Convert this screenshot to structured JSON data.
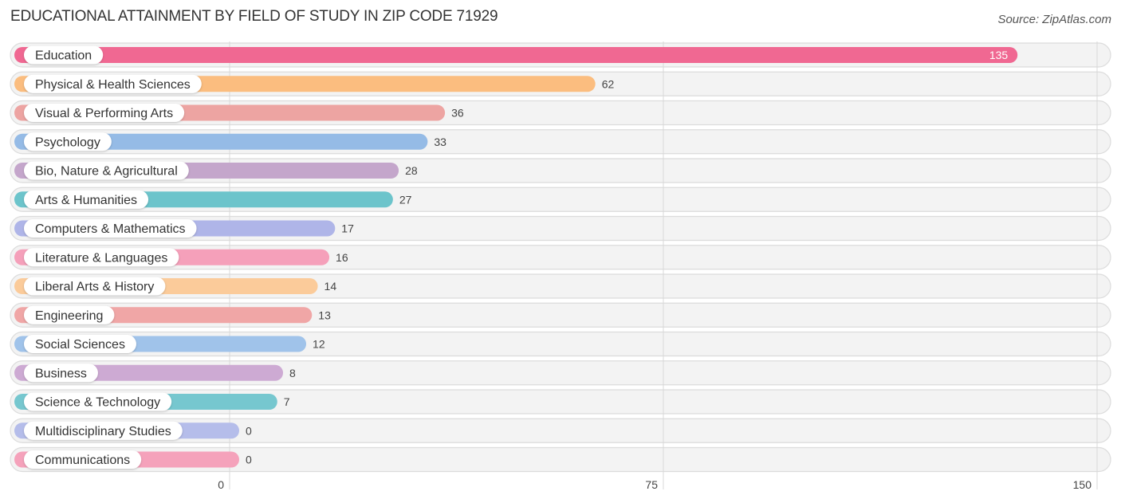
{
  "chart_data": {
    "type": "bar",
    "orientation": "horizontal",
    "title": "EDUCATIONAL ATTAINMENT BY FIELD OF STUDY IN ZIP CODE 71929",
    "source": "Source: ZipAtlas.com",
    "xlabel": "",
    "ylabel": "",
    "xlim": [
      0,
      150
    ],
    "ticks": [
      0,
      75,
      150
    ],
    "tick_labels": [
      "0",
      "75",
      "150"
    ],
    "grid": true,
    "legend": "none",
    "categories": [
      "Education",
      "Physical & Health Sciences",
      "Visual & Performing Arts",
      "Psychology",
      "Bio, Nature & Agricultural",
      "Arts & Humanities",
      "Computers & Mathematics",
      "Literature & Languages",
      "Liberal Arts & History",
      "Engineering",
      "Social Sciences",
      "Business",
      "Science & Technology",
      "Multidisciplinary Studies",
      "Communications"
    ],
    "values": [
      135,
      62,
      36,
      33,
      28,
      27,
      17,
      16,
      14,
      13,
      12,
      8,
      7,
      0,
      0
    ],
    "colors": [
      "#f06892",
      "#fbbd7f",
      "#eda4a2",
      "#95bbe6",
      "#c4a6cb",
      "#6cc4cb",
      "#afb5e8",
      "#f5a0ba",
      "#fbcb9a",
      "#f0a6a6",
      "#a0c3ea",
      "#cdaad3",
      "#76c7cf",
      "#b5bdea",
      "#f5a2bb"
    ]
  }
}
